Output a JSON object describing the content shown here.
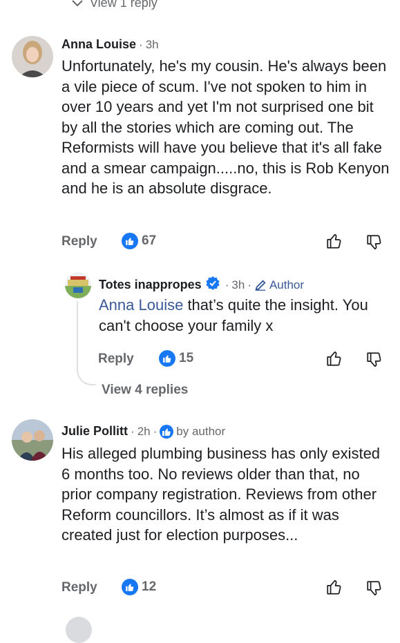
{
  "top": {
    "view_reply": "View 1 reply"
  },
  "comments": [
    {
      "name": "Anna Louise",
      "time": "3h",
      "text": "Unfortunately, he's my cousin. He's always been a vile piece of scum. I've not spoken to him in over 10 years and yet I'm not surprised one bit by all the stories which are coming out. The Reformists will have you believe that it's all fake and a smear campaign.....no, this is Rob Kenyon and he is an absolute disgrace.",
      "reply_label": "Reply",
      "likes": "67"
    },
    {
      "name": "Julie Pollitt",
      "time": "2h",
      "badge_label": "by author",
      "text": "His alleged plumbing business has only existed 6 months too. No reviews older than that, no prior company registration. Reviews from other Reform councillors. It’s almost as if it was created just for election purposes...",
      "reply_label": "Reply",
      "likes": "12"
    }
  ],
  "reply": {
    "name": "Totes inappropes",
    "time": "3h",
    "author_label": "Author",
    "mention": "Anna Louise",
    "text": " that’s quite the insight. You can't choose your family x",
    "reply_label": "Reply",
    "likes": "15",
    "view_replies": "View 4 replies"
  },
  "separator": "·",
  "colors": {
    "like_blue": "#1877f2",
    "meta_gray": "#65676b",
    "link_blue": "#385898"
  }
}
